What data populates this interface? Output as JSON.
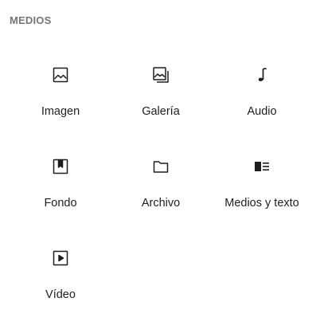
{
  "section": {
    "title": "MEDIOS"
  },
  "blocks": [
    {
      "label": "Imagen",
      "icon": "image-icon"
    },
    {
      "label": "Galería",
      "icon": "gallery-icon"
    },
    {
      "label": "Audio",
      "icon": "audio-icon"
    },
    {
      "label": "Fondo",
      "icon": "cover-icon"
    },
    {
      "label": "Archivo",
      "icon": "file-folder-icon"
    },
    {
      "label": "Medios y texto",
      "icon": "media-text-icon"
    },
    {
      "label": "Vídeo",
      "icon": "video-icon"
    }
  ],
  "colors": {
    "heading": "#757575",
    "text": "#1e1e1e",
    "background": "#ffffff"
  }
}
